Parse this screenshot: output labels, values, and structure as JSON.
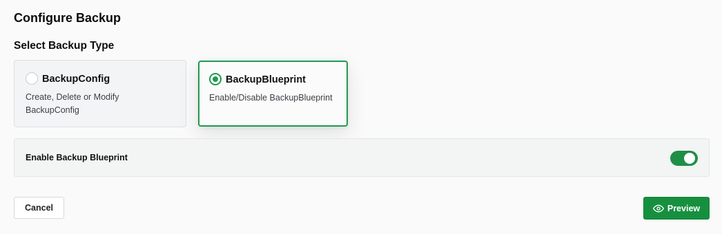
{
  "header": {
    "title": "Configure Backup"
  },
  "backup_type": {
    "heading": "Select Backup Type",
    "selected": "BackupBlueprint",
    "options": [
      {
        "label": "BackupConfig",
        "description": "Create, Delete or Modify BackupConfig",
        "selected": false
      },
      {
        "label": "BackupBlueprint",
        "description": "Enable/Disable BackupBlueprint",
        "selected": true
      }
    ]
  },
  "toggle": {
    "label": "Enable Backup Blueprint",
    "enabled": true
  },
  "footer": {
    "cancel_label": "Cancel",
    "preview_label": "Preview",
    "preview_icon": "eye-icon"
  },
  "colors": {
    "accent": "#1f9a4f",
    "primary_button": "#16903f"
  }
}
